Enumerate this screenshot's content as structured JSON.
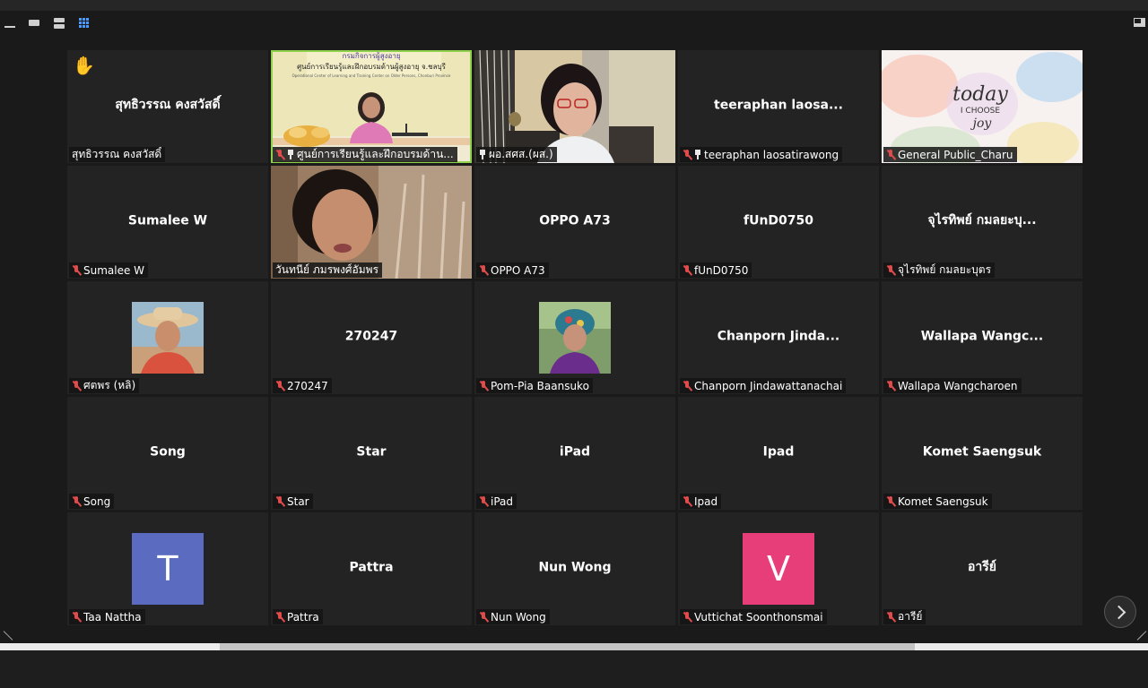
{
  "toolbar": {
    "views": [
      "minimize",
      "single",
      "speaker",
      "gallery"
    ],
    "active_view": "gallery",
    "exit_icon": "exit-fullscreen-icon"
  },
  "colors": {
    "active_border": "#8fd04c",
    "muted_mic": "#e04b4b",
    "avatar_T": "#5b6bc0",
    "avatar_V": "#e73d78",
    "gallery_icon": "#4a9cff"
  },
  "participants": [
    {
      "tile": "สุทธิวรรณ คงสวัสดิ์",
      "label": "สุทธิวรรณ คงสวัสดิ์",
      "hand": "✋",
      "muted": false,
      "pinned": false,
      "kind": "name"
    },
    {
      "label": "ศูนย์การเรียนรู้และฝึกอบรมด้าน...",
      "muted": true,
      "pinned": true,
      "kind": "video-room",
      "active": true
    },
    {
      "label": "ผอ.สศส.(ผส.)",
      "muted": false,
      "pinned": true,
      "kind": "video-woman"
    },
    {
      "tile": "teeraphan  laosa...",
      "label": "teeraphan laosatirawong",
      "muted": true,
      "pinned": true,
      "kind": "name"
    },
    {
      "label": "General Public_Charu",
      "muted": true,
      "pinned": false,
      "kind": "today-image"
    },
    {
      "tile": "Sumalee W",
      "label": "Sumalee W",
      "muted": true,
      "kind": "name"
    },
    {
      "label": "วันทนีย์ ภมรพงศ์อัมพร",
      "muted": false,
      "kind": "video-selfie"
    },
    {
      "tile": "OPPO A73",
      "label": "OPPO A73",
      "muted": true,
      "kind": "name"
    },
    {
      "tile": "fUnD0750",
      "label": "fUnD0750",
      "muted": true,
      "kind": "name"
    },
    {
      "tile": "จุไรทิพย์ กมลยะบุ...",
      "label": "จุไรทิพย์ กมลยะบุตร",
      "muted": true,
      "kind": "name"
    },
    {
      "label": "ศตพร (หลิ)",
      "muted": true,
      "kind": "photo-hat"
    },
    {
      "tile": "270247",
      "label": "270247",
      "muted": true,
      "kind": "name"
    },
    {
      "label": "Pom-Pia Baansuko",
      "muted": true,
      "kind": "photo-scarf"
    },
    {
      "tile": "Chanporn  Jinda...",
      "label": "Chanporn Jindawattanachai",
      "muted": true,
      "kind": "name"
    },
    {
      "tile": "Wallapa  Wangc...",
      "label": "Wallapa Wangcharoen",
      "muted": true,
      "kind": "name"
    },
    {
      "tile": "Song",
      "label": "Song",
      "muted": true,
      "kind": "name"
    },
    {
      "tile": "Star",
      "label": "Star",
      "muted": true,
      "kind": "name"
    },
    {
      "tile": "iPad",
      "label": "iPad",
      "muted": true,
      "kind": "name"
    },
    {
      "tile": "Ipad",
      "label": "Ipad",
      "muted": true,
      "kind": "name"
    },
    {
      "tile": "Komet Saengsuk",
      "label": "Komet Saengsuk",
      "muted": true,
      "kind": "name"
    },
    {
      "letter": "T",
      "label": "Taa Nattha",
      "muted": true,
      "kind": "letter",
      "color": "#5b6bc0"
    },
    {
      "tile": "Pattra",
      "label": "Pattra",
      "muted": true,
      "kind": "name"
    },
    {
      "tile": "Nun Wong",
      "label": "Nun Wong",
      "muted": true,
      "kind": "name"
    },
    {
      "letter": "V",
      "label": "Vuttichat Soonthonsmai",
      "muted": true,
      "kind": "letter",
      "color": "#e73d78"
    },
    {
      "tile": "อารีย์",
      "label": "อารีย์",
      "muted": true,
      "kind": "name"
    }
  ],
  "room_banner": {
    "line1": "กรมกิจการผู้สูงอายุ",
    "line2": "ศูนย์การเรียนรู้และฝึกอบรมด้านผู้สูงอายุ จ.ชลบุรี",
    "line3": "Operational Center of Learning and Training Center on Older Persons, Chonburi Province"
  },
  "today_image": {
    "line1": "today",
    "line2": "I CHOOSE",
    "line3": "joy"
  }
}
